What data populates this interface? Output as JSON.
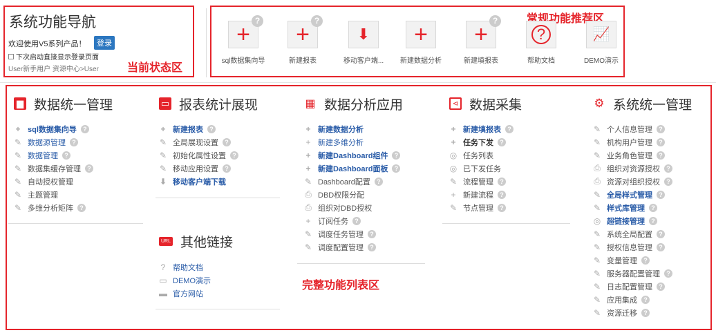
{
  "status_panel": {
    "title": "系统功能导航",
    "welcome": "欢迎使用V5系列产品！",
    "login_label": "登录",
    "auto_login_label": "下次启动直接显示登录页面",
    "user_line": "User新手用户 资源中心>User",
    "area_label": "当前状态区"
  },
  "recommend": {
    "area_label": "常规功能推荐区",
    "items": [
      {
        "label": "sql数据集向导",
        "icon": "plus-icon",
        "glyph": "+",
        "help": true
      },
      {
        "label": "新建报表",
        "icon": "plus-icon",
        "glyph": "+",
        "help": true
      },
      {
        "label": "移动客户端...",
        "icon": "download-icon",
        "glyph": "⬇",
        "help": false
      },
      {
        "label": "新建数据分析",
        "icon": "plus-icon",
        "glyph": "+",
        "help": false
      },
      {
        "label": "新建填报表",
        "icon": "plus-icon",
        "glyph": "+",
        "help": true
      },
      {
        "label": "帮助文档",
        "icon": "question-icon",
        "glyph": "?",
        "help": false
      },
      {
        "label": "DEMO演示",
        "icon": "presentation-icon",
        "glyph": "📈",
        "help": false
      }
    ]
  },
  "full_list": {
    "area_label": "完整功能列表区",
    "columns": [
      {
        "title": "数据统一管理",
        "icon_color": "#e5242b",
        "icon": "data-manage-icon",
        "items": [
          {
            "label": "sql数据集向导",
            "icon": "+",
            "style": "bold",
            "help": true
          },
          {
            "label": "数据源管理",
            "icon": "✎",
            "style": "link",
            "help": true
          },
          {
            "label": "数据管理",
            "icon": "✎",
            "style": "link",
            "help": true
          },
          {
            "label": "数据集缓存管理",
            "icon": "✎",
            "style": "normal",
            "help": true
          },
          {
            "label": "自动授权管理",
            "icon": "✎",
            "style": "normal",
            "help": false
          },
          {
            "label": "主题管理",
            "icon": "✎",
            "style": "normal",
            "help": false
          },
          {
            "label": "多维分析矩阵",
            "icon": "✎",
            "style": "normal",
            "help": true
          }
        ]
      },
      {
        "title": "报表统计展现",
        "icon_color": "#e5242b",
        "icon": "monitor-icon",
        "items": [
          {
            "label": "新建报表",
            "icon": "+",
            "style": "bold",
            "help": true
          },
          {
            "label": "全局展现设置",
            "icon": "✎",
            "style": "normal",
            "help": true
          },
          {
            "label": "初始化属性设置",
            "icon": "✎",
            "style": "normal",
            "help": true
          },
          {
            "label": "移动应用设置",
            "icon": "✎",
            "style": "normal",
            "help": true
          },
          {
            "label": "移动客户端下载",
            "icon": "⬇",
            "style": "bold",
            "help": false
          }
        ]
      },
      {
        "title": "数据分析应用",
        "icon_color": "#e5242b",
        "icon": "analysis-icon",
        "items": [
          {
            "label": "新建数据分析",
            "icon": "+",
            "style": "bold",
            "help": false
          },
          {
            "label": "新建多维分析",
            "icon": "+",
            "style": "link",
            "help": false
          },
          {
            "label": "新建Dashboard组件",
            "icon": "+",
            "style": "bold",
            "help": true
          },
          {
            "label": "新建Dashboard面板",
            "icon": "+",
            "style": "bold",
            "help": true
          },
          {
            "label": "Dashboard配置",
            "icon": "✎",
            "style": "normal",
            "help": true
          },
          {
            "label": "DBD权限分配",
            "icon": "⎙",
            "style": "normal",
            "help": false
          },
          {
            "label": "组织对DBD授权",
            "icon": "⎙",
            "style": "normal",
            "help": false
          },
          {
            "label": "订阅任务",
            "icon": "+",
            "style": "normal",
            "help": true
          },
          {
            "label": "调度任务管理",
            "icon": "✎",
            "style": "normal",
            "help": true
          },
          {
            "label": "调度配置管理",
            "icon": "✎",
            "style": "normal",
            "help": true
          }
        ]
      },
      {
        "title": "数据采集",
        "icon_color": "#e5242b",
        "icon": "collect-icon",
        "items": [
          {
            "label": "新建填报表",
            "icon": "+",
            "style": "bold",
            "help": true
          },
          {
            "label": "任务下发",
            "icon": "+",
            "style": "bold-dark",
            "help": true
          },
          {
            "label": "任务列表",
            "icon": "◎",
            "style": "normal",
            "help": false
          },
          {
            "label": "已下发任务",
            "icon": "◎",
            "style": "normal",
            "help": false
          },
          {
            "label": "流程管理",
            "icon": "✎",
            "style": "normal",
            "help": true
          },
          {
            "label": "新建流程",
            "icon": "+",
            "style": "normal",
            "help": true
          },
          {
            "label": "节点管理",
            "icon": "✎",
            "style": "normal",
            "help": true
          }
        ]
      },
      {
        "title": "系统统一管理",
        "icon_color": "#e5242b",
        "icon": "gear-icon",
        "items": [
          {
            "label": "个人信息管理",
            "icon": "✎",
            "style": "normal",
            "help": true
          },
          {
            "label": "机构用户管理",
            "icon": "✎",
            "style": "normal",
            "help": true
          },
          {
            "label": "业务角色管理",
            "icon": "✎",
            "style": "normal",
            "help": true
          },
          {
            "label": "组织对资源授权",
            "icon": "⎙",
            "style": "normal",
            "help": true
          },
          {
            "label": "资源对组织授权",
            "icon": "⎙",
            "style": "normal",
            "help": true
          },
          {
            "label": "全局样式管理",
            "icon": "✎",
            "style": "bold",
            "help": true
          },
          {
            "label": "样式库管理",
            "icon": "✎",
            "style": "bold",
            "help": true
          },
          {
            "label": "超链接管理",
            "icon": "◎",
            "style": "bold",
            "help": true
          },
          {
            "label": "系统全局配置",
            "icon": "✎",
            "style": "normal",
            "help": true
          },
          {
            "label": "授权信息管理",
            "icon": "✎",
            "style": "normal",
            "help": true
          },
          {
            "label": "变量管理",
            "icon": "✎",
            "style": "normal",
            "help": true
          },
          {
            "label": "服务器配置管理",
            "icon": "✎",
            "style": "normal",
            "help": true
          },
          {
            "label": "日志配置管理",
            "icon": "✎",
            "style": "normal",
            "help": true
          },
          {
            "label": "应用集成",
            "icon": "✎",
            "style": "normal",
            "help": true
          },
          {
            "label": "资源迁移",
            "icon": "✎",
            "style": "normal",
            "help": true
          }
        ]
      }
    ],
    "other_links": {
      "title": "其他链接",
      "badge": "URL",
      "items": [
        {
          "label": "帮助文档",
          "icon": "?"
        },
        {
          "label": "DEMO演示",
          "icon": "▭"
        },
        {
          "label": "官方网站",
          "icon": "▬"
        }
      ]
    }
  }
}
